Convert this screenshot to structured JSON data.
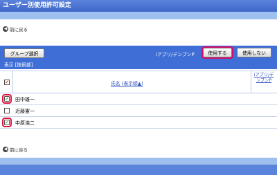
{
  "window": {
    "title": "ユーザー別使用許可設定"
  },
  "nav": {
    "back_label": "前に戻る",
    "back_icon": "back-arrow-icon"
  },
  "toolbar": {
    "group_select_label": "グループ選択",
    "app_name": "iアプリ/デンブンP",
    "use_label": "使用する",
    "not_use_label": "使用しない",
    "filter_text": "表示 [技術部]"
  },
  "table": {
    "header": {
      "name_label": "氏名 (表示順▲)",
      "app_col_label": "iアプリ/デンブンP"
    },
    "rows": [
      {
        "name": "田中雄一",
        "checked": true
      },
      {
        "name": "近藤憲一",
        "checked": false
      },
      {
        "name": "中原浩二",
        "checked": true
      }
    ]
  },
  "colors": {
    "accent": "#3f6fd6",
    "highlight": "#e0123e"
  }
}
